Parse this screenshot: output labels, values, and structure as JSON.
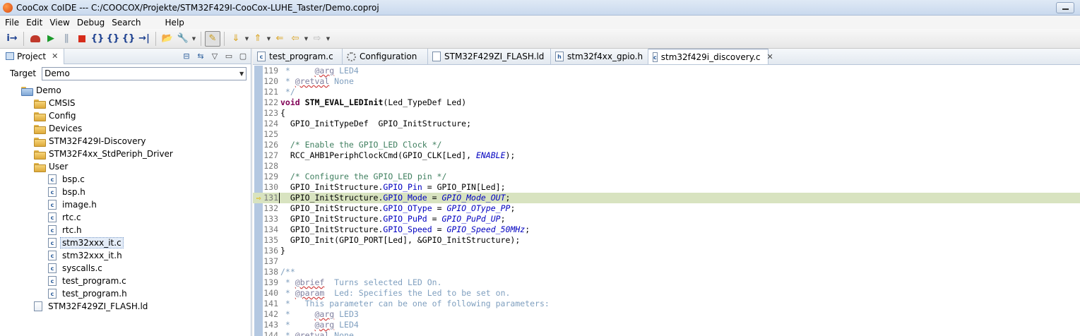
{
  "window": {
    "title": "CooCox CoIDE --- C:/COOCOX/Projekte/STM32F429I-CooCox-LUHE_Taster/Demo.coproj"
  },
  "menu": [
    "File",
    "Edit",
    "View",
    "Debug",
    "Search",
    "Help"
  ],
  "project_panel": {
    "tab_label": "Project",
    "target_label": "Target",
    "target_value": "Demo",
    "tree": [
      {
        "label": "Demo",
        "kind": "project",
        "depth": 0
      },
      {
        "label": "CMSIS",
        "kind": "folder",
        "depth": 1
      },
      {
        "label": "Config",
        "kind": "folder",
        "depth": 1
      },
      {
        "label": "Devices",
        "kind": "folder",
        "depth": 1
      },
      {
        "label": "STM32F429I-Discovery",
        "kind": "folder",
        "depth": 1
      },
      {
        "label": "STM32F4xx_StdPeriph_Driver",
        "kind": "folder",
        "depth": 1
      },
      {
        "label": "User",
        "kind": "folder",
        "depth": 1
      },
      {
        "label": "bsp.c",
        "kind": "file",
        "depth": 2
      },
      {
        "label": "bsp.h",
        "kind": "file",
        "depth": 2
      },
      {
        "label": "image.h",
        "kind": "file",
        "depth": 2
      },
      {
        "label": "rtc.c",
        "kind": "file",
        "depth": 2
      },
      {
        "label": "rtc.h",
        "kind": "file",
        "depth": 2
      },
      {
        "label": "stm32xxx_it.c",
        "kind": "file",
        "depth": 2,
        "selected": true
      },
      {
        "label": "stm32xxx_it.h",
        "kind": "file",
        "depth": 2
      },
      {
        "label": "syscalls.c",
        "kind": "file",
        "depth": 2
      },
      {
        "label": "test_program.c",
        "kind": "file",
        "depth": 2
      },
      {
        "label": "test_program.h",
        "kind": "file",
        "depth": 2
      },
      {
        "label": "STM32F429ZI_FLASH.ld",
        "kind": "ld",
        "depth": 1
      }
    ]
  },
  "editor": {
    "tabs": [
      {
        "label": "test_program.c",
        "icon": "c-file-icon",
        "active": false
      },
      {
        "label": "Configuration",
        "icon": "gear-icon",
        "active": false
      },
      {
        "label": "STM32F429ZI_FLASH.ld",
        "icon": "ld-file-icon",
        "active": false
      },
      {
        "label": "stm32f4xx_gpio.h",
        "icon": "h-file-icon",
        "active": false
      },
      {
        "label": "stm32f429i_discovery.c",
        "icon": "c-file-icon",
        "active": true
      }
    ],
    "current_line": "131",
    "lines": [
      {
        "n": "119",
        "text": " *     @arg LED4"
      },
      {
        "n": "120",
        "text": " * @retval None"
      },
      {
        "n": "121",
        "text": " */"
      },
      {
        "n": "122",
        "text": "void STM_EVAL_LEDInit(Led_TypeDef Led)"
      },
      {
        "n": "123",
        "text": "{"
      },
      {
        "n": "124",
        "text": "  GPIO_InitTypeDef  GPIO_InitStructure;"
      },
      {
        "n": "125",
        "text": ""
      },
      {
        "n": "126",
        "text": "  /* Enable the GPIO_LED Clock */"
      },
      {
        "n": "127",
        "text": "  RCC_AHB1PeriphClockCmd(GPIO_CLK[Led], ENABLE);"
      },
      {
        "n": "128",
        "text": ""
      },
      {
        "n": "129",
        "text": "  /* Configure the GPIO_LED pin */"
      },
      {
        "n": "130",
        "text": "  GPIO_InitStructure.GPIO_Pin = GPIO_PIN[Led];"
      },
      {
        "n": "131",
        "text": "  GPIO_InitStructure.GPIO_Mode = GPIO_Mode_OUT;"
      },
      {
        "n": "132",
        "text": "  GPIO_InitStructure.GPIO_OType = GPIO_OType_PP;"
      },
      {
        "n": "133",
        "text": "  GPIO_InitStructure.GPIO_PuPd = GPIO_PuPd_UP;"
      },
      {
        "n": "134",
        "text": "  GPIO_InitStructure.GPIO_Speed = GPIO_Speed_50MHz;"
      },
      {
        "n": "135",
        "text": "  GPIO_Init(GPIO_PORT[Led], &GPIO_InitStructure);"
      },
      {
        "n": "136",
        "text": "}"
      },
      {
        "n": "137",
        "text": ""
      },
      {
        "n": "138",
        "text": "/**"
      },
      {
        "n": "139",
        "text": " * @brief  Turns selected LED On."
      },
      {
        "n": "140",
        "text": " * @param  Led: Specifies the Led to be set on."
      },
      {
        "n": "141",
        "text": " *   This parameter can be one of following parameters:"
      },
      {
        "n": "142",
        "text": " *     @arg LED3"
      },
      {
        "n": "143",
        "text": " *     @arg LED4"
      },
      {
        "n": "144",
        "text": " * @retval None"
      }
    ]
  },
  "colors": {
    "comment": "#3f7f5f",
    "keyword": "#7f0055",
    "field": "#0000c0",
    "current_line_bg": "#d8e3c0",
    "ruler": "#b4c8e1"
  }
}
